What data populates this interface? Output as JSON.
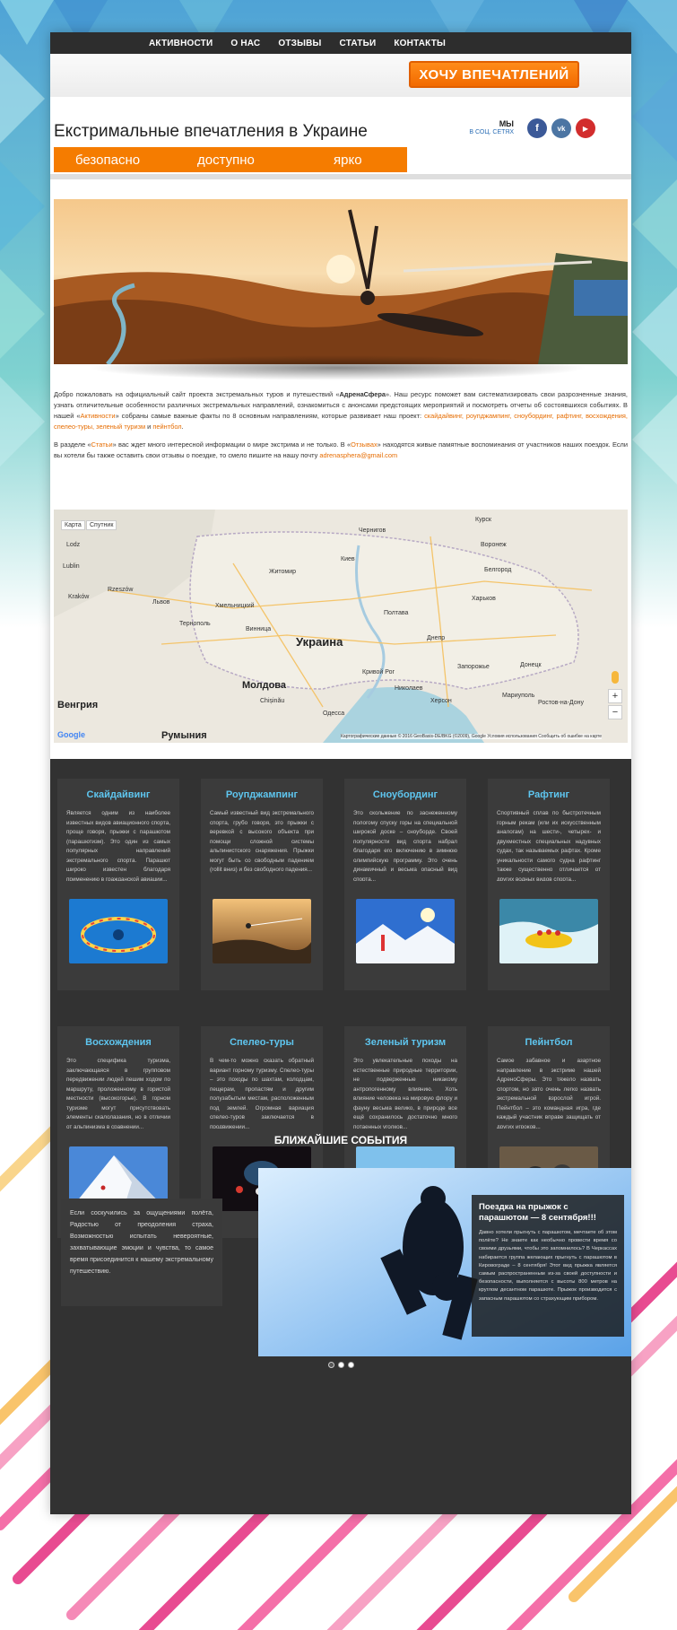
{
  "nav": {
    "items": [
      "АКТИВНОСТИ",
      "О НАС",
      "ОТЗЫВЫ",
      "СТАТЬИ",
      "КОНТАКТЫ"
    ]
  },
  "header": {
    "cta_label": "ХОЧУ ВПЕЧАТЛЕНИЙ",
    "title": "Екстримальные впечатления в Украине",
    "slogans": [
      "безопасно",
      "доступно",
      "ярко"
    ],
    "social_label_1": "МЫ",
    "social_label_2": "В СОЦ. СЕТЯХ",
    "social": [
      {
        "icon": "facebook-icon",
        "glyph": "f",
        "color": "#3b5998"
      },
      {
        "icon": "vk-icon",
        "glyph": "vk",
        "color": "#4c75a3"
      },
      {
        "icon": "youtube-icon",
        "glyph": "▶",
        "color": "#d22d2d"
      }
    ]
  },
  "intro": {
    "p1_a": "Добро пожаловать на официальный сайт проекта экстремальных туров и путешествий «",
    "p1_brand": "АдренаСфера",
    "p1_b": "». Наш ресурс поможет вам систематизировать свои разрозненные знания, узнать отличительные особенности различных экстремальных направлений, ознакомиться с анонсами предстоящих мероприятий и посмотреть отчеты об состоявшихся событиях. В нашей «",
    "p1_link": "Активности",
    "p1_c": "» собраны самые важные факты по 8 основным направлениям, которые развивает наш проект: ",
    "p1_list": "скайдайвинг, роупджампинг, сноубординг, рафтинг, восхождения, спелео-туры, зеленый туризм",
    "p1_and": " и ",
    "p1_last": "пейнтбол",
    "p1_end": ".",
    "p2_a": "В разделе «",
    "p2_link1": "Статьи",
    "p2_b": "» вас ждет много интересной информации о мире экстрима и не только. В «",
    "p2_link2": "Отзывах",
    "p2_c": "» находятся живые памятные воспоминания от участников наших поездок. Если вы хотели бы также оставить свои отзывы о поездке, то смело пишите на нашу почту ",
    "p2_email": "adrenasphera@gmail.com"
  },
  "map": {
    "country": "Украина",
    "tabs": [
      "Карта",
      "Спутник"
    ],
    "labels": [
      "Lodz",
      "Lublin",
      "Kraków",
      "Rzeszów",
      "Львов",
      "Житомир",
      "Киев",
      "Чернигов",
      "Воронеж",
      "Харьков",
      "Полтава",
      "Днепр",
      "Донецк",
      "Запорожье",
      "Одесса",
      "Молдова",
      "Венгрия",
      "Chișinău",
      "Ростов-на-Дону",
      "Мариуполь",
      "Белгород",
      "Курск",
      "Тернополь",
      "Винница",
      "Хмельницкий",
      "Кривой Рог",
      "Николаев",
      "Херсон",
      "Румыния"
    ],
    "attribution": "Картографические данные © 2016 GeoBasis-DE/BKG (©2009), Google   Условия использования   Сообщить об ошибке на карте",
    "google": "Google"
  },
  "activities": [
    {
      "title": "Скайдайвинг",
      "text": "Является одним из наиболее известных видов авиационного спорта, проще говоря, прыжки с парашютом (парашютизм). Это один из самых популярных направлений экстремального спорта. Парашют широко известен благодаря применению в гражданской авиации..."
    },
    {
      "title": "Роупджампинг",
      "text": "Самый известный вид экстремального спорта, грубо говоря, это прыжки с веревкой с высокого объекта при помощи сложной системы альпинистского снаряжения. Прыжки могут быть со свободным падением (rollit вниз) и без свободного падения..."
    },
    {
      "title": "Сноубординг",
      "text": "Это скольжение по заснеженному пологому спуску горы на специальной широкой доске – сноуборде. Своей популярности вид спорта набрал благодаря его включению в зимнюю олимпийскую программу. Это очень динамичный и весьма опасный вид спорта..."
    },
    {
      "title": "Рафтинг",
      "text": "Спортивный сплав по быстротечным горным рекам (или их искусственным аналогам) на шести-, четырех- и двухместных специальных надувных судах, так называемых рафтах. Кроме уникальности самого судна рафтинг также существенно отличается от других водных видов спорта..."
    },
    {
      "title": "Восхождения",
      "text": "Это специфика туризма, заключающаяся в групповом передвижении людей пешим ходом по маршруту, проложенному в гористой местности (высокогорье). В горном туризме могут присутствовать элементы скалолазания, но в отличии от альпинизма в сравнении..."
    },
    {
      "title": "Спелео-туры",
      "text": "В чем-то можно сказать обратный вариант горному туризму. Спелео-туры – это походы по шахтам, колодцам, пещерам, пропастям и другим полузабытым местам, расположенным под землей. Огромная вариация спелео-туров заключается в продвижении..."
    },
    {
      "title": "Зеленый туризм",
      "text": "Это увлекательные походы на естественные природные территории, не подверженные никакому антропогенному влиянию. Хоть влияние человека на мировую флору и фауну весьма велико, в природе все ещё сохранилось достаточно много потаенных уголков..."
    },
    {
      "title": "Пейнтбол",
      "text": "Самое забавное и азартное направление в экстриме нашей АдреноСферы. Это тяжело назвать спортом, но зато очень легко назвать экстремальной взрослой игрой. Пейнтбол – это командная игра, где каждый участник вправе защищать от других игроков..."
    }
  ],
  "events": {
    "title": "БЛИЖАЙШИЕ СОБЫТИЯ",
    "intro": "Если соскучились за ощущениями полёта, Радостью от преодоления страха, Возможностью испытать невероятные, захватывающие эмоции и чувства, то самое время присоединится к нашему экстремальному путешествию.",
    "slide_title": "Поездка на прыжок с парашютом — 8 сентября!!!",
    "slide_text": "Давно хотели прыгнуть с парашютом, мечтаете об этом полёте? Не знаете как необычно провести время со своими друзьями, чтобы это запомнилось? В Черкассах набирается группа желающих прыгнуть с парашютом в Кировограде – 8 сентября! Этот вид прыжка является самым распространенным из-за своей доступности и безопасности, выполняется с высоты 800 метров на круглом десантном парашюте. Прыжок производится с запасным парашютом со страхующим прибором.",
    "slide_count": 3,
    "active_slide": 1
  }
}
